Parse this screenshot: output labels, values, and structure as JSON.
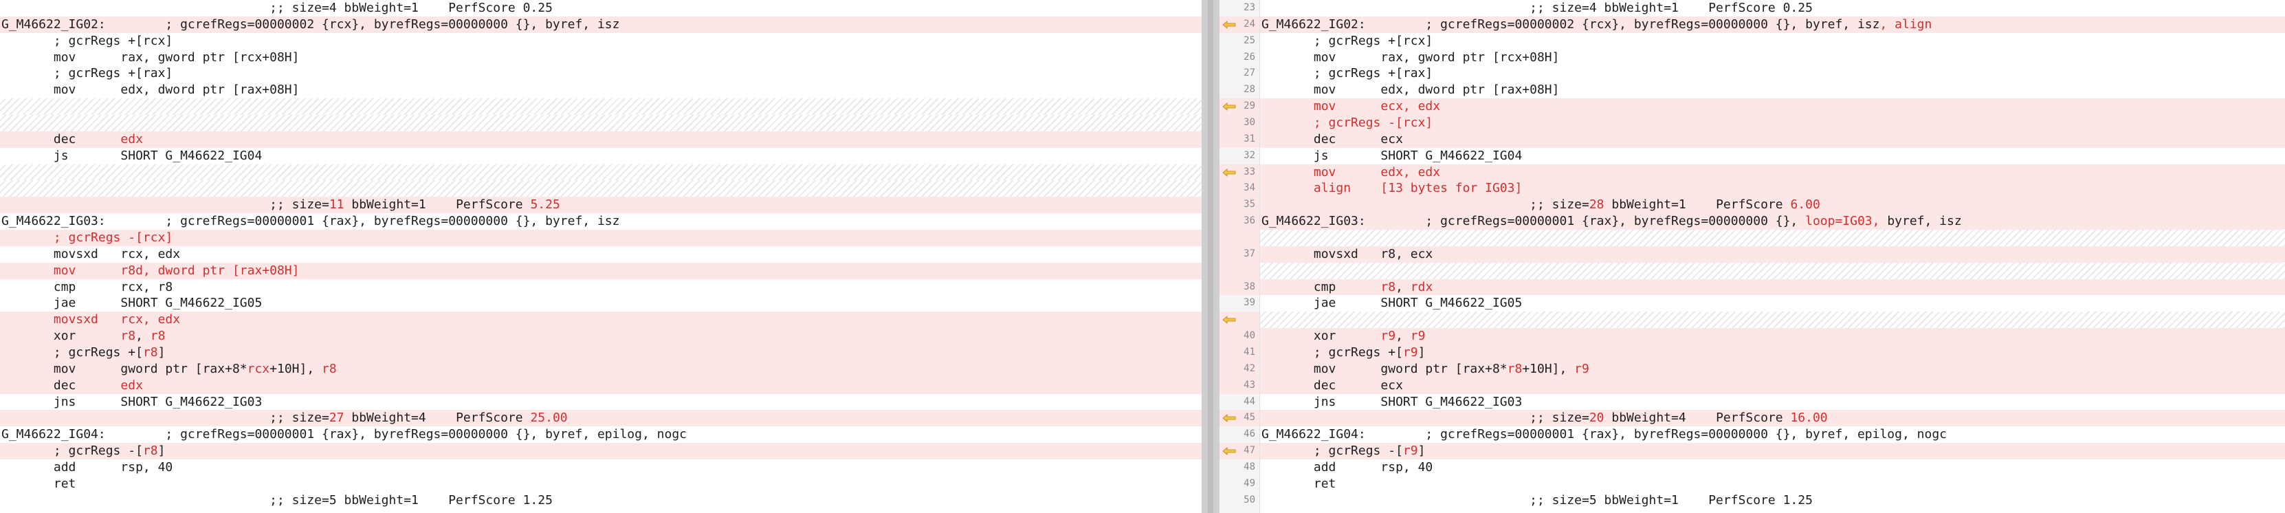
{
  "colors": {
    "changed_row_bg": "#fde6e6",
    "changed_text": "#d32f2f",
    "gutter_bg": "#f4f4f4",
    "arrow_fill": "#f6c343"
  },
  "left": {
    "rows": [
      {
        "type": "ctx",
        "text": "                                    ;; size=4 bbWeight=1    PerfScore 0.25"
      },
      {
        "type": "del",
        "text": "G_M46622_IG02:        ; gcrefRegs=00000002 {rcx}, byrefRegs=00000000 {}, byref, isz"
      },
      {
        "type": "ctx",
        "text": "       ; gcrRegs +[rcx]"
      },
      {
        "type": "ctx",
        "text": "       mov      rax, gword ptr [rcx+08H]"
      },
      {
        "type": "ctx",
        "text": "       ; gcrRegs +[rax]"
      },
      {
        "type": "ctx",
        "text": "       mov      edx, dword ptr [rax+08H]"
      },
      {
        "type": "pad",
        "text": ""
      },
      {
        "type": "pad",
        "text": ""
      },
      {
        "type": "del",
        "text": "       dec      edx",
        "hl": "edx"
      },
      {
        "type": "ctx",
        "text": "       js       SHORT G_M46622_IG04"
      },
      {
        "type": "pad",
        "text": ""
      },
      {
        "type": "pad",
        "text": ""
      },
      {
        "type": "del",
        "text": "                                    ;; size=11 bbWeight=1    PerfScore 5.25",
        "hl": "11|5.25"
      },
      {
        "type": "ctx",
        "text": "G_M46622_IG03:        ; gcrefRegs=00000001 {rax}, byrefRegs=00000000 {}, byref, isz"
      },
      {
        "type": "del",
        "text": "       ; gcrRegs -[rcx]",
        "hl": "all"
      },
      {
        "type": "ctx",
        "text": "       movsxd   rcx, edx"
      },
      {
        "type": "del",
        "text": "       mov      r8d, dword ptr [rax+08H]",
        "hl": "all"
      },
      {
        "type": "ctx",
        "text": "       cmp      rcx, r8"
      },
      {
        "type": "ctx",
        "text": "       jae      SHORT G_M46622_IG05"
      },
      {
        "type": "del",
        "text": "       movsxd   rcx, edx",
        "hl": "all"
      },
      {
        "type": "del",
        "text": "       xor      r8, r8",
        "hl": "r8"
      },
      {
        "type": "del",
        "text": "       ; gcrRegs +[r8]",
        "hl": "r8"
      },
      {
        "type": "del",
        "text": "       mov      gword ptr [rax+8*rcx+10H], r8",
        "hl": "rcx|r8"
      },
      {
        "type": "del",
        "text": "       dec      edx",
        "hl": "edx"
      },
      {
        "type": "ctx",
        "text": "       jns      SHORT G_M46622_IG03"
      },
      {
        "type": "del",
        "text": "                                    ;; size=27 bbWeight=4    PerfScore 25.00",
        "hl": "27|25.00"
      },
      {
        "type": "ctx",
        "text": "G_M46622_IG04:        ; gcrefRegs=00000001 {rax}, byrefRegs=00000000 {}, byref, epilog, nogc"
      },
      {
        "type": "del",
        "text": "       ; gcrRegs -[r8]",
        "hl": "r8"
      },
      {
        "type": "ctx",
        "text": "       add      rsp, 40"
      },
      {
        "type": "ctx",
        "text": "       ret"
      },
      {
        "type": "ctx",
        "text": "                                    ;; size=5 bbWeight=1    PerfScore 1.25"
      }
    ]
  },
  "right": {
    "rows": [
      {
        "type": "ctx",
        "num": "23",
        "text": "                                    ;; size=4 bbWeight=1    PerfScore 0.25"
      },
      {
        "type": "add",
        "num": "24",
        "arrow": true,
        "text": "G_M46622_IG02:        ; gcrefRegs=00000002 {rcx}, byrefRegs=00000000 {}, byref, isz, align",
        "hl": ", align"
      },
      {
        "type": "ctx",
        "num": "25",
        "text": "       ; gcrRegs +[rcx]"
      },
      {
        "type": "ctx",
        "num": "26",
        "text": "       mov      rax, gword ptr [rcx+08H]"
      },
      {
        "type": "ctx",
        "num": "27",
        "text": "       ; gcrRegs +[rax]"
      },
      {
        "type": "ctx",
        "num": "28",
        "text": "       mov      edx, dword ptr [rax+08H]"
      },
      {
        "type": "add",
        "num": "29",
        "arrow": true,
        "text": "       mov      ecx, edx",
        "hl": "all"
      },
      {
        "type": "add",
        "num": "30",
        "text": "       ; gcrRegs -[rcx]",
        "hl": "all"
      },
      {
        "type": "add",
        "num": "31",
        "text": "       dec      ecx"
      },
      {
        "type": "ctx",
        "num": "32",
        "text": "       js       SHORT G_M46622_IG04"
      },
      {
        "type": "add",
        "num": "33",
        "arrow": true,
        "text": "       mov      edx, edx",
        "hl": "all"
      },
      {
        "type": "add",
        "num": "34",
        "text": "       align    [13 bytes for IG03]",
        "hl": "all"
      },
      {
        "type": "add",
        "num": "35",
        "text": "                                    ;; size=28 bbWeight=1    PerfScore 6.00",
        "hl": "28|6.00"
      },
      {
        "type": "add",
        "num": "36",
        "text": "G_M46622_IG03:        ; gcrefRegs=00000001 {rax}, byrefRegs=00000000 {}, loop=IG03, byref, isz",
        "hl": "loop=IG03,"
      },
      {
        "type": "pad",
        "num": "",
        "text": ""
      },
      {
        "type": "add",
        "num": "37",
        "text": "       movsxd   r8, ecx"
      },
      {
        "type": "pad",
        "num": "",
        "text": ""
      },
      {
        "type": "add",
        "num": "38",
        "text": "       cmp      r8, rdx",
        "hl": "r8|rdx"
      },
      {
        "type": "ctx",
        "num": "39",
        "text": "       jae      SHORT G_M46622_IG05"
      },
      {
        "type": "pad",
        "num": "",
        "arrow": true,
        "text": ""
      },
      {
        "type": "add",
        "num": "40",
        "text": "       xor      r9, r9",
        "hl": "r9"
      },
      {
        "type": "add",
        "num": "41",
        "text": "       ; gcrRegs +[r9]",
        "hl": "r9"
      },
      {
        "type": "add",
        "num": "42",
        "text": "       mov      gword ptr [rax+8*r8+10H], r9",
        "hl": "r8|r9"
      },
      {
        "type": "add",
        "num": "43",
        "text": "       dec      ecx"
      },
      {
        "type": "ctx",
        "num": "44",
        "text": "       jns      SHORT G_M46622_IG03"
      },
      {
        "type": "add",
        "num": "45",
        "arrow": true,
        "text": "                                    ;; size=20 bbWeight=4    PerfScore 16.00",
        "hl": "20|16.00"
      },
      {
        "type": "ctx",
        "num": "46",
        "text": "G_M46622_IG04:        ; gcrefRegs=00000001 {rax}, byrefRegs=00000000 {}, byref, epilog, nogc"
      },
      {
        "type": "add",
        "num": "47",
        "arrow": true,
        "text": "       ; gcrRegs -[r9]",
        "hl": "r9"
      },
      {
        "type": "ctx",
        "num": "48",
        "text": "       add      rsp, 40"
      },
      {
        "type": "ctx",
        "num": "49",
        "text": "       ret"
      },
      {
        "type": "ctx",
        "num": "50",
        "text": "                                    ;; size=5 bbWeight=1    PerfScore 1.25"
      }
    ]
  }
}
